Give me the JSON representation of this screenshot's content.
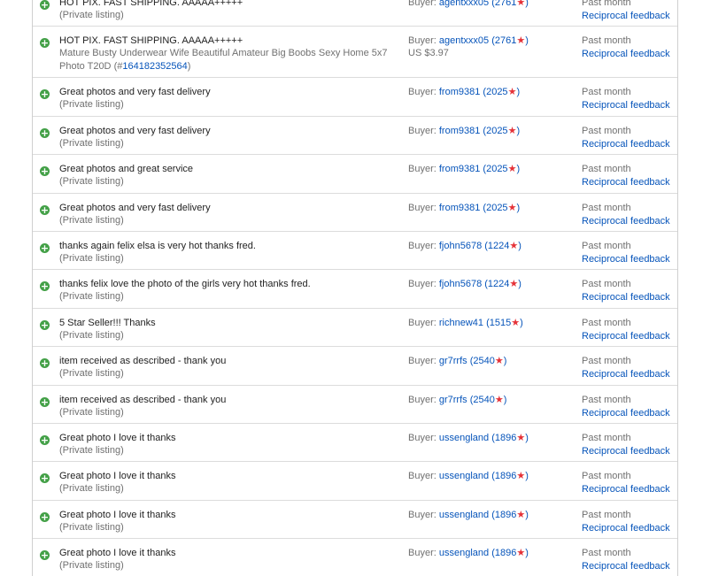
{
  "labels": {
    "buyer_prefix": "Buyer:",
    "private_listing": "(Private listing)",
    "date": "Past month",
    "reciprocal": "Reciprocal feedback",
    "star": "★",
    "positive_icon": "plus-circle-icon"
  },
  "rows": [
    {
      "comment": "HOT PIX. FAST SHIPPING. AAAAA+++++",
      "buyer": "agentxxx05",
      "score": "2761"
    },
    {
      "comment": "HOT PIX. FAST SHIPPING. AAAAA+++++",
      "buyer": "agentxxx05",
      "score": "2761",
      "item_title": "Mature Busty Underwear Wife Beautiful Amateur Big Boobs Sexy Home 5x7 Photo T20D",
      "item_number": "164182352564",
      "price": "US $3.97"
    },
    {
      "comment": "Great photos and very fast delivery",
      "buyer": "from9381",
      "score": "2025"
    },
    {
      "comment": "Great photos and very fast delivery",
      "buyer": "from9381",
      "score": "2025"
    },
    {
      "comment": "Great photos and great service",
      "buyer": "from9381",
      "score": "2025"
    },
    {
      "comment": "Great photos and very fast delivery",
      "buyer": "from9381",
      "score": "2025"
    },
    {
      "comment": "thanks again felix elsa is very hot thanks fred.",
      "buyer": "fjohn5678",
      "score": "1224"
    },
    {
      "comment": "thanks felix love the photo of the girls very hot thanks fred.",
      "buyer": "fjohn5678",
      "score": "1224"
    },
    {
      "comment": "5 Star Seller!!! Thanks",
      "buyer": "richnew41",
      "score": "1515"
    },
    {
      "comment": "item received as described - thank you",
      "buyer": "gr7rrfs",
      "score": "2540"
    },
    {
      "comment": "item received as described - thank you",
      "buyer": "gr7rrfs",
      "score": "2540"
    },
    {
      "comment": "Great photo I love it thanks",
      "buyer": "ussengland",
      "score": "1896"
    },
    {
      "comment": "Great photo I love it thanks",
      "buyer": "ussengland",
      "score": "1896"
    },
    {
      "comment": "Great photo I love it thanks",
      "buyer": "ussengland",
      "score": "1896"
    },
    {
      "comment": "Great photo I love it thanks",
      "buyer": "ussengland",
      "score": "1896"
    }
  ]
}
